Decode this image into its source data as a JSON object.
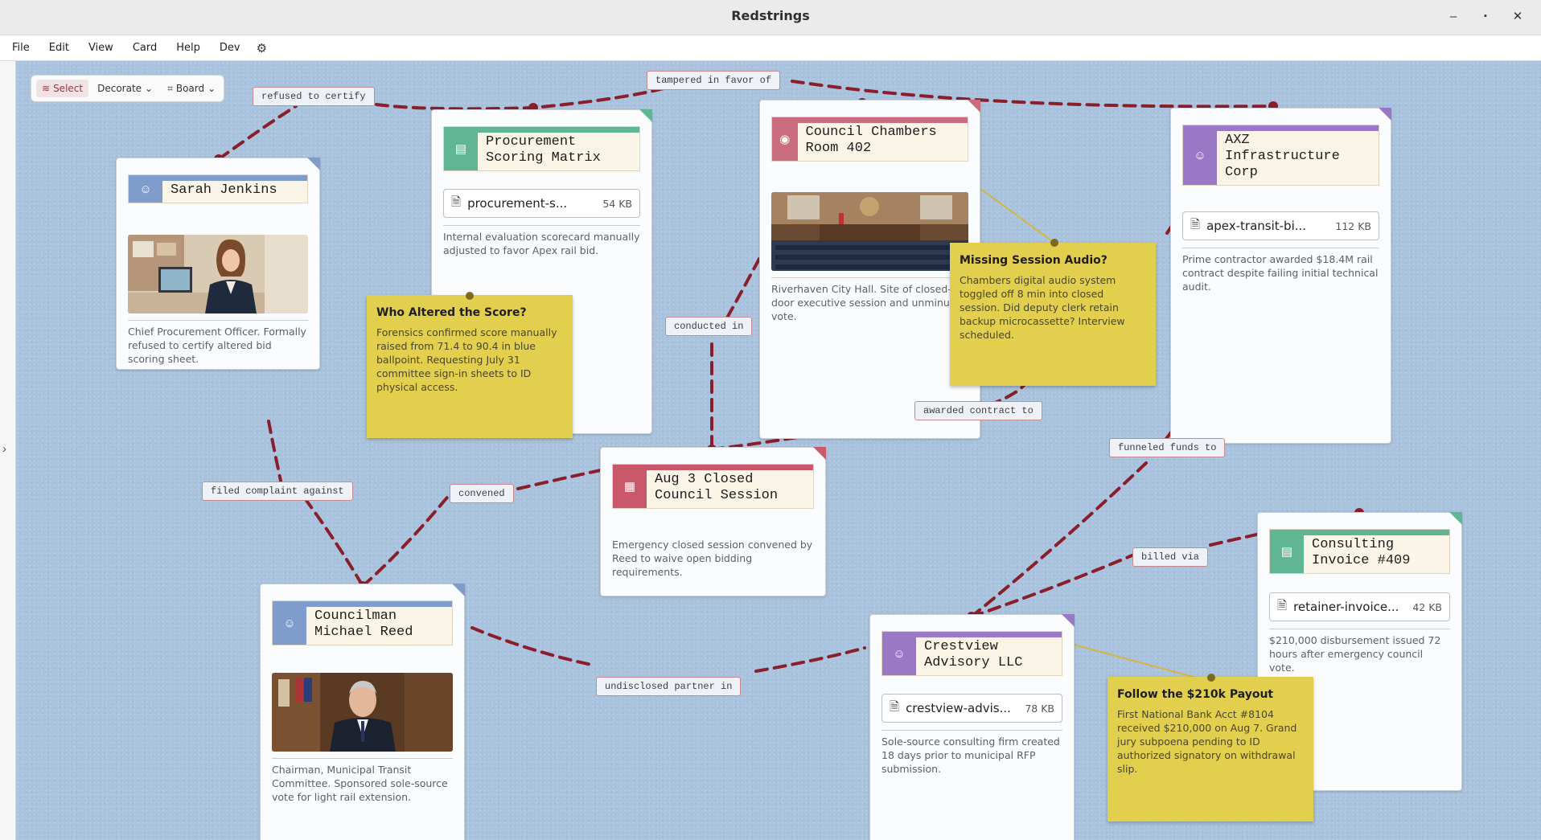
{
  "window": {
    "title": "Redstrings",
    "minimize": "–",
    "maximize": "▪",
    "close": "✕"
  },
  "menu": {
    "items": [
      "File",
      "Edit",
      "View",
      "Card",
      "Help",
      "Dev"
    ]
  },
  "toolbar": {
    "select": "Select",
    "decorate": "Decorate",
    "board": "Board"
  },
  "colors": {
    "link": "#8a1e2a",
    "note": "#e2cf4e",
    "person": "#7f9ccc",
    "document": "#5fb594",
    "location": "#c96c7e",
    "event": "#c9596a",
    "org": "#9b78c6"
  },
  "cards": {
    "sarah": {
      "title": "Sarah Jenkins",
      "type": "person-icon",
      "desc": "Chief Procurement Officer. Formally refused to certify altered bid scoring sheet."
    },
    "matrix": {
      "title": "Procurement Scoring Matrix",
      "type": "document-icon",
      "file_name": "procurement-s...",
      "file_size": "54 KB",
      "desc": "Internal evaluation scorecard manually adjusted to favor Apex rail bid."
    },
    "chambers": {
      "title": "Council Chambers Room 402",
      "type": "location-icon",
      "desc": "Riverhaven City Hall. Site of closed-door executive session and unminuted vote."
    },
    "axz": {
      "title": "AXZ Infrastructure Corp",
      "type": "person-icon",
      "file_name": "apex-transit-bi...",
      "file_size": "112 KB",
      "desc": "Prime contractor awarded $18.4M rail contract despite failing initial technical audit."
    },
    "session": {
      "title": "Aug 3 Closed Council Session",
      "type": "calendar-icon",
      "desc": "Emergency closed session convened by Reed to waive open bidding requirements."
    },
    "reed": {
      "title": "Councilman Michael Reed",
      "type": "person-icon",
      "desc": "Chairman, Municipal Transit Committee. Sponsored sole-source vote for light rail extension."
    },
    "crestview": {
      "title": "Crestview Advisory LLC",
      "type": "person-icon",
      "file_name": "crestview-advis...",
      "file_size": "78 KB",
      "desc": "Sole-source consulting firm created 18 days prior to municipal RFP submission."
    },
    "invoice": {
      "title": "Consulting Invoice #409",
      "type": "document-icon",
      "file_name": "retainer-invoice...",
      "file_size": "42 KB",
      "desc": "$210,000 disbursement issued 72 hours after emergency council vote."
    }
  },
  "notes": {
    "score": {
      "title": "Who Altered the Score?",
      "body": "Forensics confirmed score manually raised from 71.4 to 90.4 in blue ballpoint. Requesting July 31 committee sign-in sheets to ID physical access."
    },
    "audio": {
      "title": "Missing Session Audio?",
      "body": "Chambers digital audio system toggled off 8 min into closed session. Did deputy clerk retain backup microcassette? Interview scheduled."
    },
    "payout": {
      "title": "Follow the $210k Payout",
      "body": "First National Bank Acct #8104 received $210,000 on Aug 7. Grand jury subpoena pending to ID authorized signatory on withdrawal slip."
    }
  },
  "links": {
    "refused": "refused to certify",
    "tampered": "tampered in favor of",
    "conducted": "conducted in",
    "awarded": "awarded contract to",
    "funneled": "funneled funds to",
    "complaint": "filed complaint against",
    "convened": "convened",
    "billed": "billed via",
    "partner": "undisclosed partner in"
  }
}
